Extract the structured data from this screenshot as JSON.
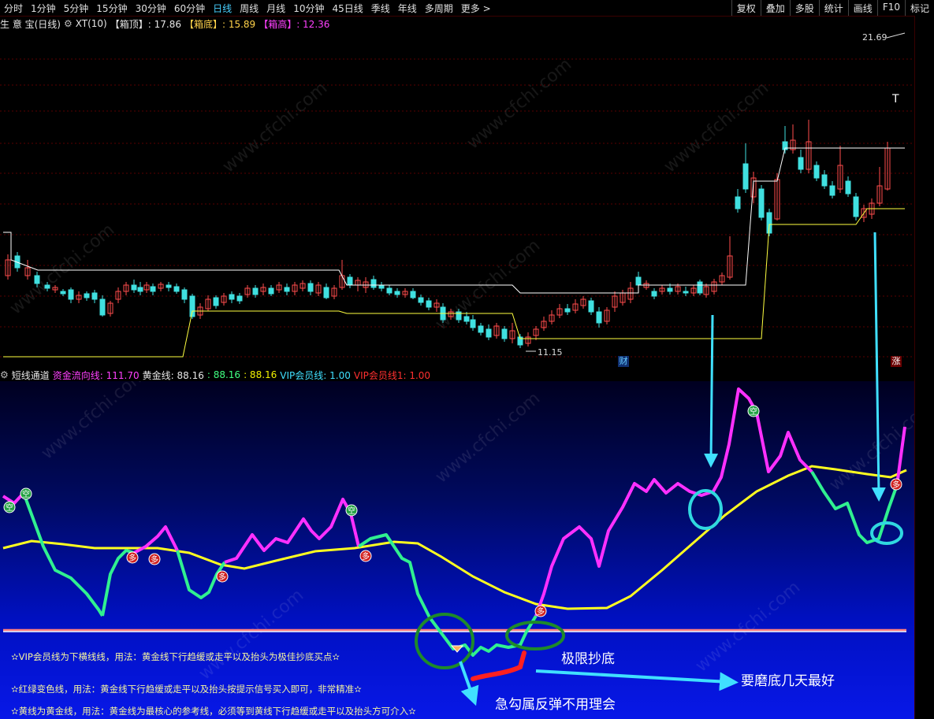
{
  "toolbar": {
    "periods": [
      "分时",
      "1分钟",
      "5分钟",
      "15分钟",
      "30分钟",
      "60分钟",
      "日线",
      "周线",
      "月线",
      "10分钟",
      "45日线",
      "季线",
      "年线",
      "多周期",
      "更多 >"
    ],
    "active": "日线",
    "right_buttons": [
      "复权",
      "叠加",
      "多股",
      "统计",
      "画线",
      "F10",
      "标记"
    ]
  },
  "main_header": {
    "stock": "生 意 宝(日线)",
    "indicator": "XT(10)",
    "top_label": "【箱顶】: 17.86",
    "bottom_label": "【箱底】: 15.89",
    "height_label": "【箱高】: 12.36"
  },
  "price_labels": {
    "high": "21.69",
    "low": "11.15"
  },
  "badges": {
    "cai": "财",
    "zhang": "涨"
  },
  "sub_header": {
    "name": "短线通道",
    "fund_line": "资金流向线: 111.70",
    "gold_line_label": "黄金线: 88.16",
    "gold_val2": ": 88.16",
    "gold_val3": ": 88.16",
    "vip_line": "VIP会员线: 1.00",
    "vip_line1": "VIP会员线1: 1.00"
  },
  "signals": {
    "kong": "空",
    "duo": "多"
  },
  "notes": [
    "✫VIP会员线为下横线线，用法：黄金线下行趋缓或走平以及抬头为极佳抄底买点✫",
    "✫红绿变色线，用法：黄金线下行趋缓或走平以及抬头按提示信号买入即可，非常精准✫",
    "✫黄线为黄金线，用法：黄金线为最核心的参考线，必须等到黄线下行趋缓或走平以及抬头方可介入✫"
  ],
  "annotations": {
    "bottom_extreme": "极限抄底",
    "grind_bottom": "要磨底几天最好",
    "sharp_hook": "急勾属反弹不用理会"
  },
  "watermark": "www.cfchi.com",
  "colors": {
    "up": "#ff4d4d",
    "down": "#40e0e0",
    "gold": "#ffff20",
    "fund_up": "#ff30ff",
    "fund_down": "#30f090",
    "box_top": "#ffffff",
    "box_bottom": "#ffff40"
  }
}
